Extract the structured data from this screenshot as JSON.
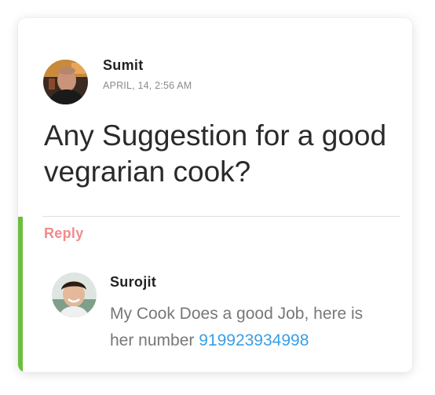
{
  "post": {
    "author": "Sumit",
    "date": "APRIL, 14, 2:56 AM",
    "text": "Any Suggestion for a good vegrarian cook?"
  },
  "reply_action": {
    "label": "Reply"
  },
  "reply": {
    "author": "Surojit",
    "text_before": "My Cook Does a good Job, here is her number ",
    "phone": "919923934998"
  },
  "colors": {
    "accent_bar": "#6abf3c",
    "reply_link": "#f28b8b",
    "phone_link": "#3a9ee4"
  },
  "icons": {
    "post_avatar": "user-avatar-photo",
    "reply_avatar": "user-avatar-photo"
  }
}
